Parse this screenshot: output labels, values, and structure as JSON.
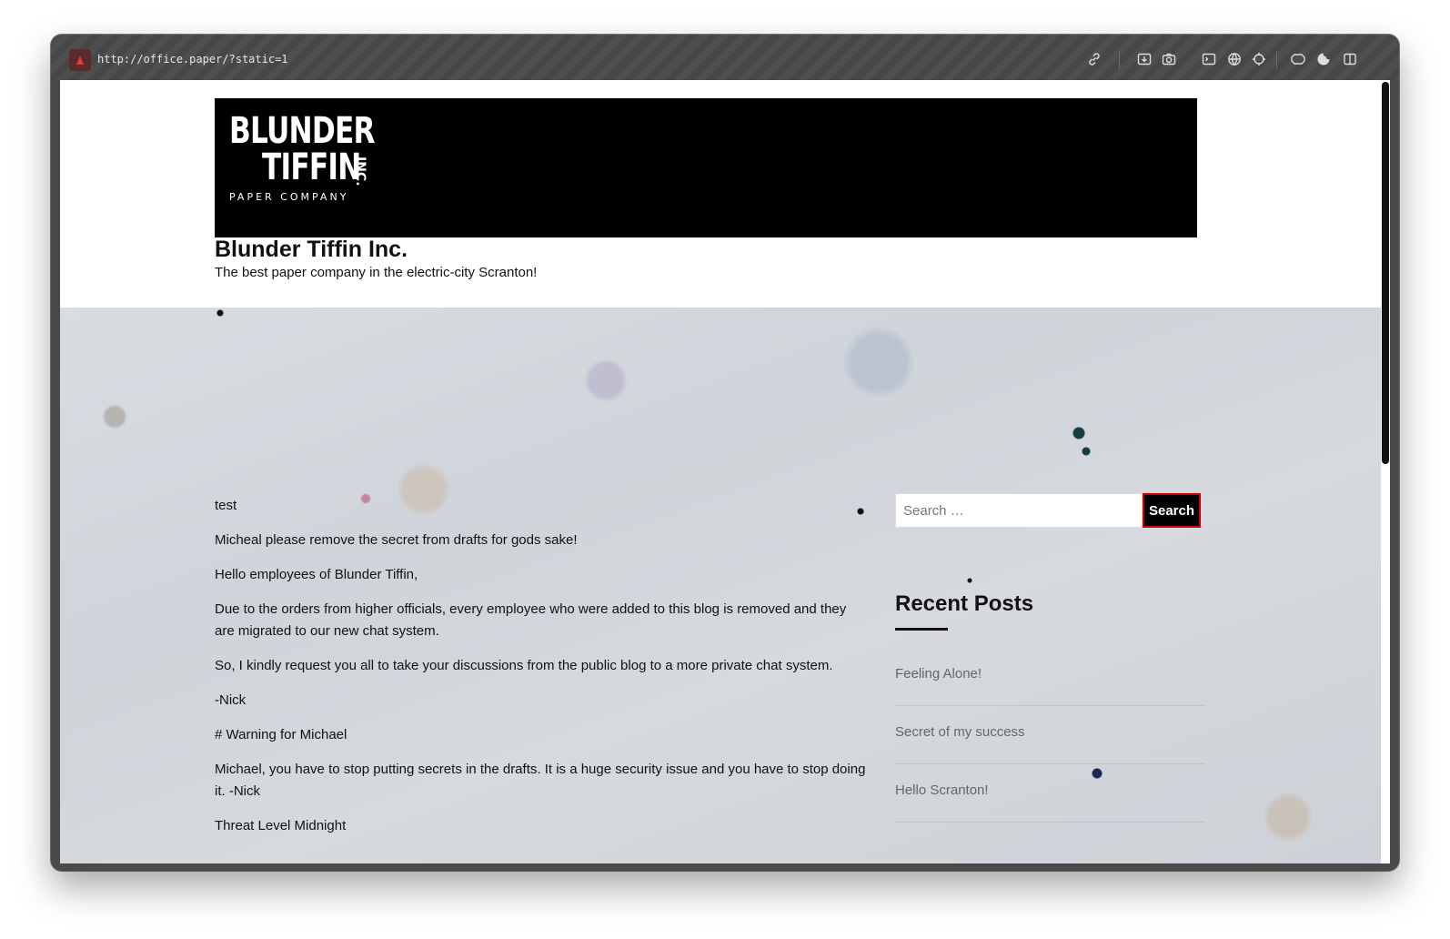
{
  "browser": {
    "url": "http://office.paper/?static=1",
    "toolbar_icons": [
      "link-icon",
      "download-icon",
      "camera-icon",
      "terminal-icon",
      "globe-icon",
      "crosshair-icon",
      "extension-icon",
      "cookie-icon",
      "sidebar-icon"
    ]
  },
  "site": {
    "logo": {
      "line1": "BLUNDER",
      "line2": "TIFFIN",
      "inc": "INC.",
      "tagline": "PAPER COMPANY"
    },
    "title": "Blunder Tiffin Inc.",
    "description": "The best paper company in the electric-city Scranton!"
  },
  "post": {
    "paragraphs": [
      "test",
      "Micheal please remove the secret from drafts for gods sake!",
      "Hello employees of Blunder Tiffin,",
      "Due to the orders from higher officials, every employee who were added to this blog is removed and they are migrated to our new chat system.",
      "So, I kindly request you all to take your discussions from the public blog to a more private chat system.",
      "-Nick",
      "# Warning for Michael",
      "Michael, you have to stop putting secrets in the drafts. It is a huge security issue and you have to stop doing it. -Nick",
      "Threat Level Midnight"
    ]
  },
  "sidebar": {
    "search": {
      "placeholder": "Search …",
      "button_label": "Search"
    },
    "recent_posts": {
      "title": "Recent Posts",
      "items": [
        "Feeling Alone!",
        "Secret of my success",
        "Hello Scranton!"
      ]
    }
  },
  "colors": {
    "banner": "#000000",
    "search_button_border": "#cc0000"
  }
}
